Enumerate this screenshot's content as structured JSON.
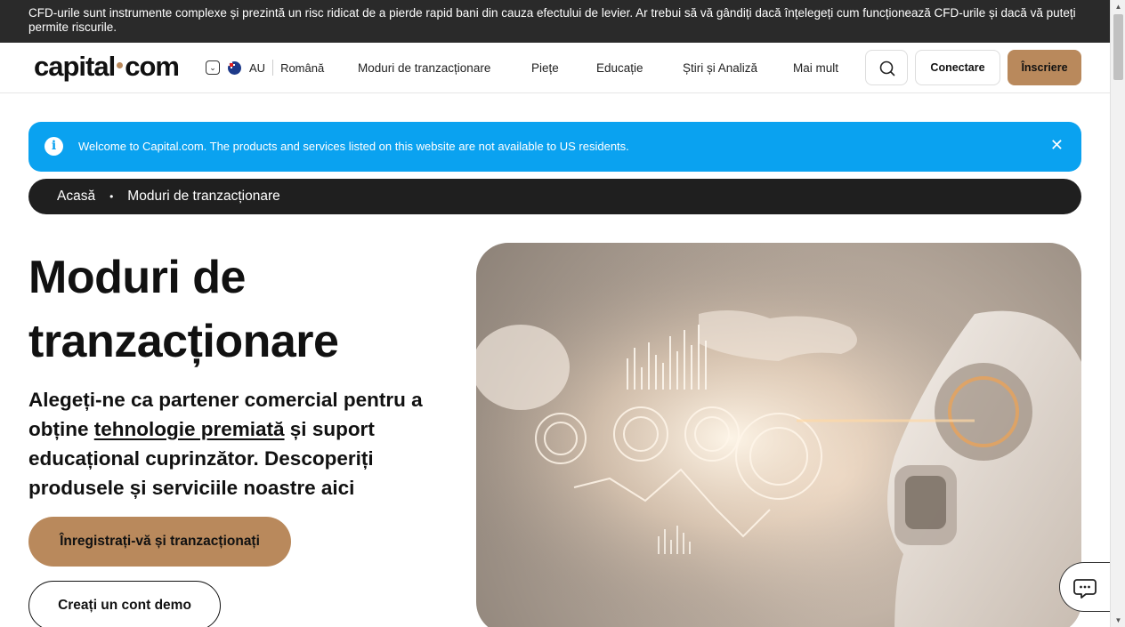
{
  "risk_warning": "CFD-urile sunt instrumente complexe și prezintă un risc ridicat de a pierde rapid bani din cauza efectului de levier. Ar trebui să vă gândiți dacă înțelegeți cum funcționează CFD-urile și dacă vă puteți permite riscurile.",
  "header": {
    "logo_left": "capital",
    "logo_right": "com",
    "region_code": "AU",
    "language": "Română",
    "nav": [
      "Moduri de tranzacționare",
      "Piețe",
      "Educație",
      "Știri și Analiză",
      "Mai mult"
    ],
    "login_label": "Conectare",
    "signup_label": "Înscriere"
  },
  "notice": {
    "message": "Welcome to Capital.com. The products and services listed on this website are not available to US residents.",
    "close_glyph": "✕"
  },
  "breadcrumb": {
    "items": [
      "Acasă",
      "Moduri de tranzacționare"
    ],
    "separator": "•"
  },
  "hero": {
    "title_line1": "Moduri de",
    "title_line2": "tranzacționare",
    "subtitle_before": "Alegeți-ne ca partener comercial pentru a obține ",
    "subtitle_link": "tehnologie premiată",
    "subtitle_after": " și suport educațional cuprinzător. Descoperiți produsele și serviciile noastre aici",
    "cta_primary": "Înregistrați-vă și tranzacționați",
    "cta_secondary": "Creați un cont demo"
  },
  "icons": {
    "region_dropdown": "chevron-down-icon",
    "flag": "australia-flag-icon",
    "search": "search-icon",
    "info": "info-icon",
    "close": "close-icon",
    "chat": "chat-icon"
  },
  "colors": {
    "accent": "#b9895c",
    "notice_bg": "#0aa2f0",
    "dark_bar": "#2a2a2a"
  }
}
